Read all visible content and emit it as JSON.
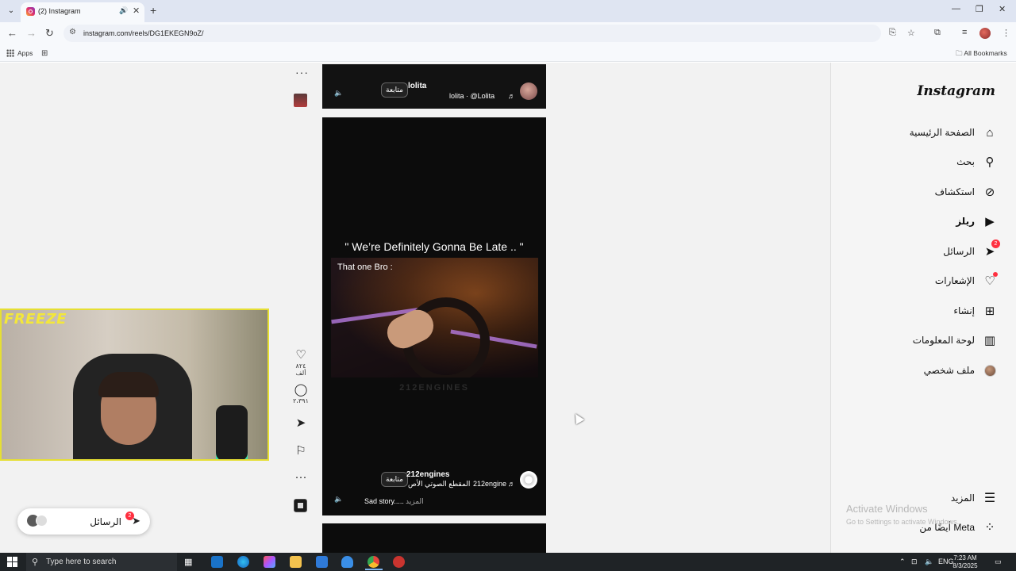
{
  "browser": {
    "tab_title": "(2) Instagram",
    "url": "instagram.com/reels/DG1EKEGN9oZ/",
    "bookmarks": {
      "apps_label": "Apps",
      "all_bookmarks": "All Bookmarks"
    },
    "icons": [
      "tab-list-icon",
      "audio-icon",
      "close-icon",
      "new-tab-icon",
      "minimize-icon",
      "restore-icon",
      "window-close-icon",
      "back-icon",
      "forward-icon",
      "reload-icon",
      "site-info-icon",
      "install-icon",
      "star-icon",
      "extensions-icon",
      "tab-search-icon",
      "menu-icon"
    ]
  },
  "sidebar": {
    "logo": "Instagram",
    "items": [
      {
        "label": "الصفحة الرئيسية",
        "icon": "home-icon",
        "symbol": "⌂"
      },
      {
        "label": "بحث",
        "icon": "search-icon",
        "symbol": "⚲"
      },
      {
        "label": "استكشاف",
        "icon": "compass-icon",
        "symbol": "⊘"
      },
      {
        "label": "ريلز",
        "icon": "reels-icon",
        "symbol": "▶",
        "active": true
      },
      {
        "label": "الرسائل",
        "icon": "send-icon",
        "symbol": "➤",
        "badge": "2"
      },
      {
        "label": "الإشعارات",
        "icon": "heart-icon",
        "symbol": "♡",
        "dot": true
      },
      {
        "label": "إنشاء",
        "icon": "plus-icon",
        "symbol": "⊞"
      },
      {
        "label": "لوحة المعلومات",
        "icon": "dashboard-icon",
        "symbol": "▥"
      },
      {
        "label": "ملف شخصي",
        "icon": "profile-avatar",
        "symbol": ""
      }
    ],
    "more": {
      "label": "المزيد",
      "icon": "hamburger-icon",
      "symbol": "☰"
    },
    "meta": {
      "label": "أيضًا من Meta",
      "icon": "meta-grid-icon",
      "symbol": "⁘"
    }
  },
  "watermark": {
    "line1": "Activate Windows",
    "line2": "Go to Settings to activate Windows."
  },
  "reels": {
    "top": {
      "username": "lolita",
      "follow": "متابعة",
      "audio": "lolita · @Lolita"
    },
    "main": {
      "caption": "\" We’re Definitely Gonna Be Late .. \"",
      "video_label": "That one Bro :",
      "video_watermark": "212ENGINES",
      "username": "212engines",
      "follow": "متابعة",
      "audio_text": "المقطع الصوتي الأص",
      "audio_owner": "212engine",
      "description": "Sad story.....",
      "more": "المزيد"
    },
    "actions": {
      "likes": "٨٢٤ ألف",
      "comments": "٢،٣٩١"
    }
  },
  "overlay": {
    "streamer_logo": "FREEZE"
  },
  "messages_pill": {
    "label": "الرسائل",
    "badge": "2"
  },
  "taskbar": {
    "search_placeholder": "Type here to search",
    "lang": "ENG",
    "time": "7:23 AM",
    "date": "8/3/2025"
  },
  "colors": {
    "instagram_badge": "#ff3040",
    "webcam_border": "#e6df33",
    "freeze_text": "#f3e73a"
  }
}
